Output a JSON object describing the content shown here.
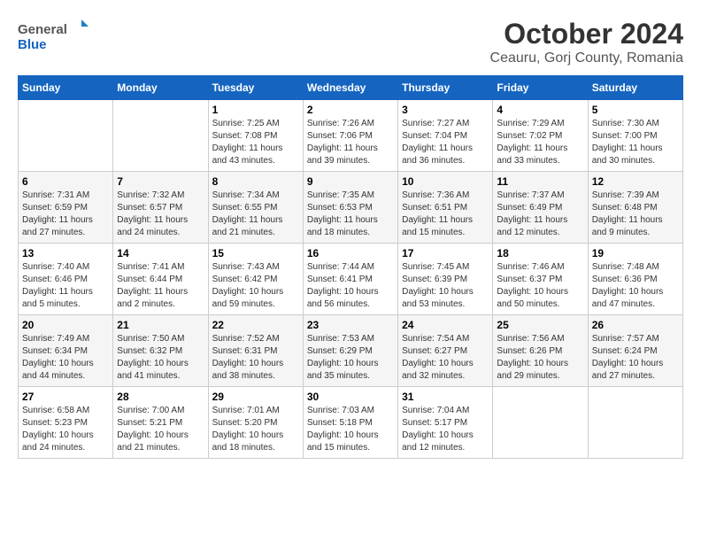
{
  "logo": {
    "general": "General",
    "blue": "Blue"
  },
  "title": {
    "month": "October 2024",
    "location": "Ceauru, Gorj County, Romania"
  },
  "weekdays": [
    "Sunday",
    "Monday",
    "Tuesday",
    "Wednesday",
    "Thursday",
    "Friday",
    "Saturday"
  ],
  "weeks": [
    [
      {
        "day": null
      },
      {
        "day": null
      },
      {
        "day": 1,
        "sunrise": "7:25 AM",
        "sunset": "7:08 PM",
        "daylight": "11 hours and 43 minutes."
      },
      {
        "day": 2,
        "sunrise": "7:26 AM",
        "sunset": "7:06 PM",
        "daylight": "11 hours and 39 minutes."
      },
      {
        "day": 3,
        "sunrise": "7:27 AM",
        "sunset": "7:04 PM",
        "daylight": "11 hours and 36 minutes."
      },
      {
        "day": 4,
        "sunrise": "7:29 AM",
        "sunset": "7:02 PM",
        "daylight": "11 hours and 33 minutes."
      },
      {
        "day": 5,
        "sunrise": "7:30 AM",
        "sunset": "7:00 PM",
        "daylight": "11 hours and 30 minutes."
      }
    ],
    [
      {
        "day": 6,
        "sunrise": "7:31 AM",
        "sunset": "6:59 PM",
        "daylight": "11 hours and 27 minutes."
      },
      {
        "day": 7,
        "sunrise": "7:32 AM",
        "sunset": "6:57 PM",
        "daylight": "11 hours and 24 minutes."
      },
      {
        "day": 8,
        "sunrise": "7:34 AM",
        "sunset": "6:55 PM",
        "daylight": "11 hours and 21 minutes."
      },
      {
        "day": 9,
        "sunrise": "7:35 AM",
        "sunset": "6:53 PM",
        "daylight": "11 hours and 18 minutes."
      },
      {
        "day": 10,
        "sunrise": "7:36 AM",
        "sunset": "6:51 PM",
        "daylight": "11 hours and 15 minutes."
      },
      {
        "day": 11,
        "sunrise": "7:37 AM",
        "sunset": "6:49 PM",
        "daylight": "11 hours and 12 minutes."
      },
      {
        "day": 12,
        "sunrise": "7:39 AM",
        "sunset": "6:48 PM",
        "daylight": "11 hours and 9 minutes."
      }
    ],
    [
      {
        "day": 13,
        "sunrise": "7:40 AM",
        "sunset": "6:46 PM",
        "daylight": "11 hours and 5 minutes."
      },
      {
        "day": 14,
        "sunrise": "7:41 AM",
        "sunset": "6:44 PM",
        "daylight": "11 hours and 2 minutes."
      },
      {
        "day": 15,
        "sunrise": "7:43 AM",
        "sunset": "6:42 PM",
        "daylight": "10 hours and 59 minutes."
      },
      {
        "day": 16,
        "sunrise": "7:44 AM",
        "sunset": "6:41 PM",
        "daylight": "10 hours and 56 minutes."
      },
      {
        "day": 17,
        "sunrise": "7:45 AM",
        "sunset": "6:39 PM",
        "daylight": "10 hours and 53 minutes."
      },
      {
        "day": 18,
        "sunrise": "7:46 AM",
        "sunset": "6:37 PM",
        "daylight": "10 hours and 50 minutes."
      },
      {
        "day": 19,
        "sunrise": "7:48 AM",
        "sunset": "6:36 PM",
        "daylight": "10 hours and 47 minutes."
      }
    ],
    [
      {
        "day": 20,
        "sunrise": "7:49 AM",
        "sunset": "6:34 PM",
        "daylight": "10 hours and 44 minutes."
      },
      {
        "day": 21,
        "sunrise": "7:50 AM",
        "sunset": "6:32 PM",
        "daylight": "10 hours and 41 minutes."
      },
      {
        "day": 22,
        "sunrise": "7:52 AM",
        "sunset": "6:31 PM",
        "daylight": "10 hours and 38 minutes."
      },
      {
        "day": 23,
        "sunrise": "7:53 AM",
        "sunset": "6:29 PM",
        "daylight": "10 hours and 35 minutes."
      },
      {
        "day": 24,
        "sunrise": "7:54 AM",
        "sunset": "6:27 PM",
        "daylight": "10 hours and 32 minutes."
      },
      {
        "day": 25,
        "sunrise": "7:56 AM",
        "sunset": "6:26 PM",
        "daylight": "10 hours and 29 minutes."
      },
      {
        "day": 26,
        "sunrise": "7:57 AM",
        "sunset": "6:24 PM",
        "daylight": "10 hours and 27 minutes."
      }
    ],
    [
      {
        "day": 27,
        "sunrise": "6:58 AM",
        "sunset": "5:23 PM",
        "daylight": "10 hours and 24 minutes."
      },
      {
        "day": 28,
        "sunrise": "7:00 AM",
        "sunset": "5:21 PM",
        "daylight": "10 hours and 21 minutes."
      },
      {
        "day": 29,
        "sunrise": "7:01 AM",
        "sunset": "5:20 PM",
        "daylight": "10 hours and 18 minutes."
      },
      {
        "day": 30,
        "sunrise": "7:03 AM",
        "sunset": "5:18 PM",
        "daylight": "10 hours and 15 minutes."
      },
      {
        "day": 31,
        "sunrise": "7:04 AM",
        "sunset": "5:17 PM",
        "daylight": "10 hours and 12 minutes."
      },
      {
        "day": null
      },
      {
        "day": null
      }
    ]
  ]
}
